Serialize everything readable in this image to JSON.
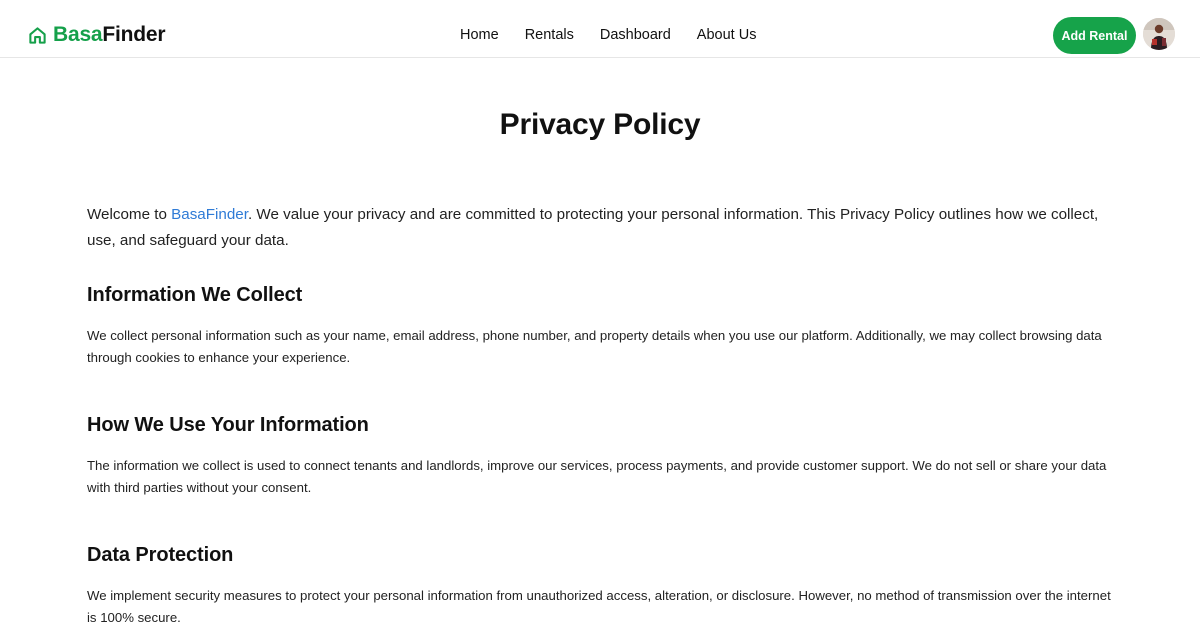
{
  "header": {
    "brand": {
      "part1": "Basa",
      "part2": "Finder"
    },
    "nav": [
      {
        "label": "Home"
      },
      {
        "label": "Rentals"
      },
      {
        "label": "Dashboard"
      },
      {
        "label": "About Us"
      }
    ],
    "add_rental_label": "Add Rental",
    "icons": {
      "logo": "house-icon",
      "avatar": "user-avatar"
    },
    "colors": {
      "brand_green": "#16a34a",
      "link_blue": "#2f7bd6"
    }
  },
  "main": {
    "title": "Privacy Policy",
    "intro": {
      "prefix": "Welcome to ",
      "brand": "BasaFinder",
      "suffix": ". We value your privacy and are committed to protecting your personal information. This Privacy Policy outlines how we collect, use, and safeguard your data."
    },
    "sections": [
      {
        "heading": "Information We Collect",
        "body": "We collect personal information such as your name, email address, phone number, and property details when you use our platform. Additionally, we may collect browsing data through cookies to enhance your experience."
      },
      {
        "heading": "How We Use Your Information",
        "body": "The information we collect is used to connect tenants and landlords, improve our services, process payments, and provide customer support. We do not sell or share your data with third parties without your consent."
      },
      {
        "heading": "Data Protection",
        "body": "We implement security measures to protect your personal information from unauthorized access, alteration, or disclosure. However, no method of transmission over the internet is 100% secure."
      }
    ]
  }
}
